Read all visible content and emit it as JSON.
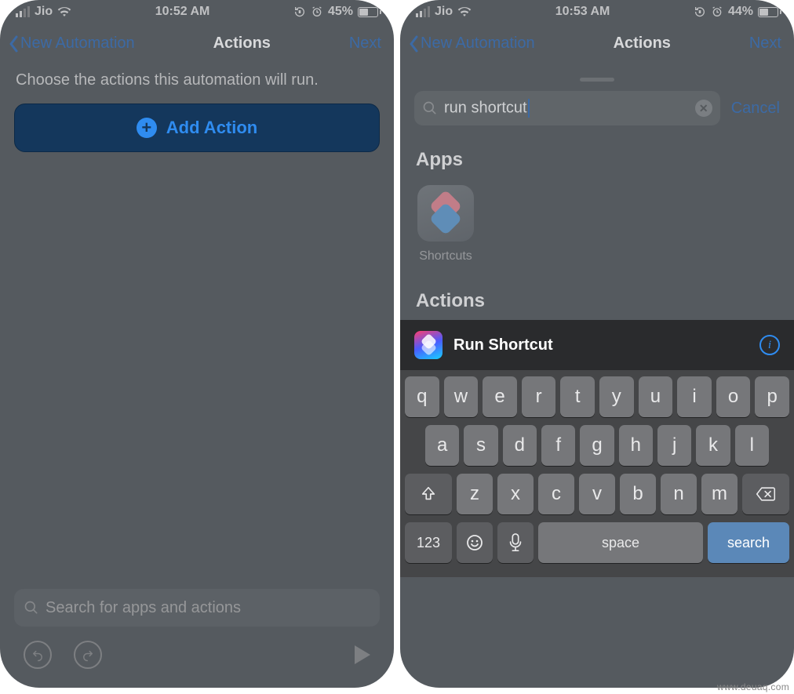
{
  "left": {
    "status": {
      "carrier": "Jio",
      "time": "10:52 AM",
      "battery": "45%"
    },
    "nav": {
      "back": "New Automation",
      "title": "Actions",
      "next": "Next"
    },
    "choose": "Choose the actions this automation will run.",
    "add_action": "Add Action",
    "search_placeholder": "Search for apps and actions"
  },
  "right": {
    "status": {
      "carrier": "Jio",
      "time": "10:53 AM",
      "battery": "44%"
    },
    "nav": {
      "back": "New Automation",
      "title": "Actions",
      "next": "Next"
    },
    "search": {
      "query": "run  shortcut",
      "cancel": "Cancel"
    },
    "apps_title": "Apps",
    "app": {
      "label": "Shortcuts"
    },
    "actions_title": "Actions",
    "result": {
      "label": "Run Shortcut"
    },
    "keyboard": {
      "row1": [
        "q",
        "w",
        "e",
        "r",
        "t",
        "y",
        "u",
        "i",
        "o",
        "p"
      ],
      "row2": [
        "a",
        "s",
        "d",
        "f",
        "g",
        "h",
        "j",
        "k",
        "l"
      ],
      "row3": [
        "z",
        "x",
        "c",
        "v",
        "b",
        "n",
        "m"
      ],
      "num": "123",
      "space": "space",
      "search": "search"
    }
  },
  "watermark": "www.deuaq.com"
}
